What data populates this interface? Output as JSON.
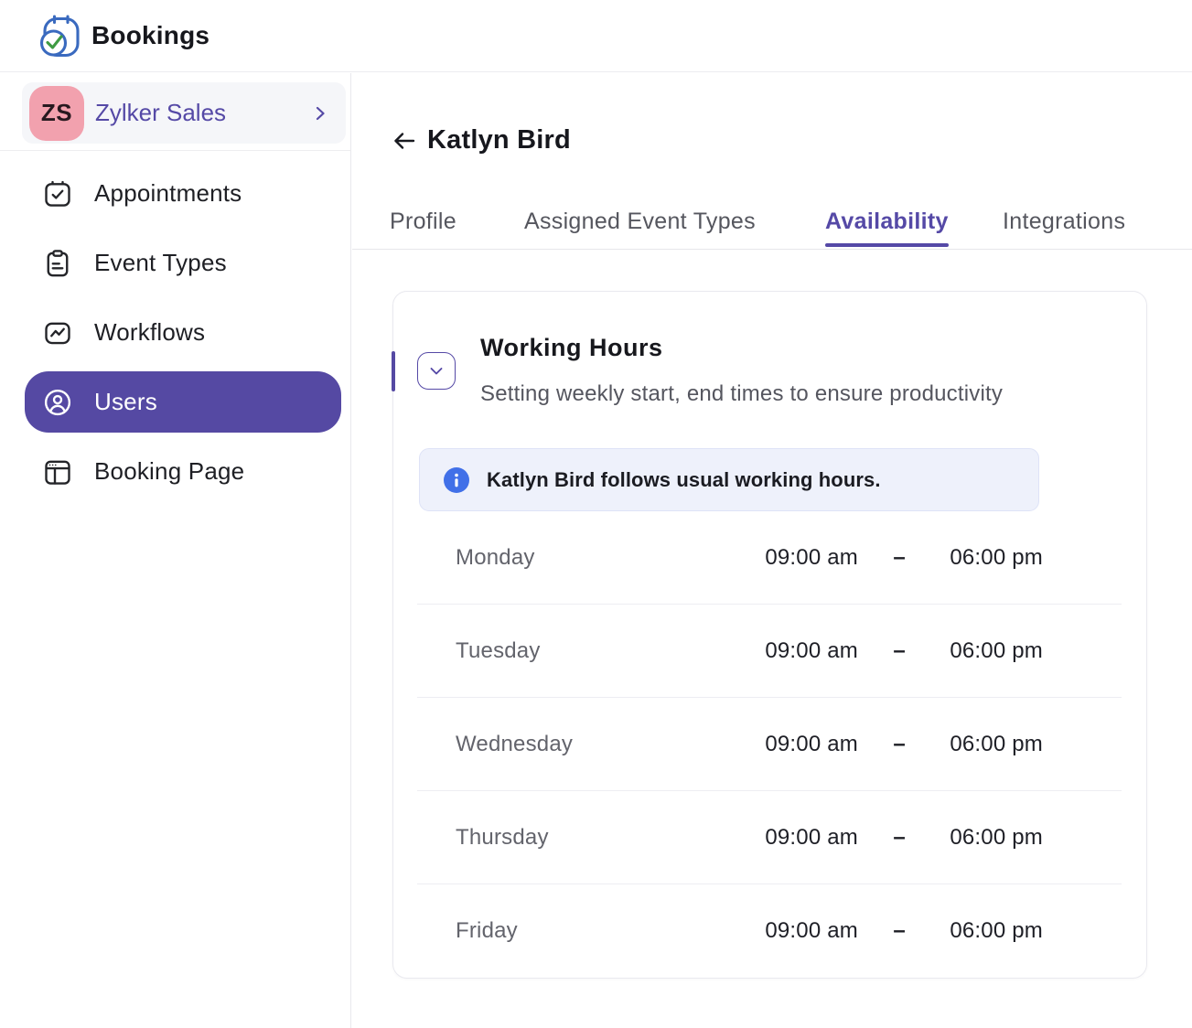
{
  "app": {
    "title": "Bookings",
    "logo_icon": "bookings-calendar-check-logo"
  },
  "sidebar": {
    "org": {
      "initials": "ZS",
      "name": "Zylker Sales",
      "chevron_icon": "chevron-right-icon"
    },
    "items": [
      {
        "label": "Appointments",
        "icon": "calendar-check-icon",
        "active": false
      },
      {
        "label": "Event Types",
        "icon": "clipboard-icon",
        "active": false
      },
      {
        "label": "Workflows",
        "icon": "workflow-pulse-icon",
        "active": false
      },
      {
        "label": "Users",
        "icon": "user-circle-icon",
        "active": true
      },
      {
        "label": "Booking Page",
        "icon": "browser-window-icon",
        "active": false
      }
    ]
  },
  "page": {
    "title": "Katlyn Bird",
    "back_icon": "arrow-left-icon"
  },
  "tabs": [
    {
      "label": "Profile",
      "active": false
    },
    {
      "label": "Assigned Event Types",
      "active": false
    },
    {
      "label": "Availability",
      "active": true
    },
    {
      "label": "Integrations",
      "active": false
    }
  ],
  "working_hours": {
    "title": "Working Hours",
    "subtitle": "Setting weekly start, end times to ensure productivity",
    "collapse_icon": "chevron-down-icon",
    "notice": {
      "icon": "info-icon",
      "text": "Katlyn Bird follows usual working hours."
    },
    "rows": [
      {
        "day": "Monday",
        "start": "09:00 am",
        "separator": "–",
        "end": "06:00 pm"
      },
      {
        "day": "Tuesday",
        "start": "09:00 am",
        "separator": "–",
        "end": "06:00 pm"
      },
      {
        "day": "Wednesday",
        "start": "09:00 am",
        "separator": "–",
        "end": "06:00 pm"
      },
      {
        "day": "Thursday",
        "start": "09:00 am",
        "separator": "–",
        "end": "06:00 pm"
      },
      {
        "day": "Friday",
        "start": "09:00 am",
        "separator": "–",
        "end": "06:00 pm"
      }
    ]
  },
  "colors": {
    "accent_purple": "#5549a3",
    "avatar_pink": "#f2a1ae",
    "info_blue": "#4170e8",
    "notice_bg": "#eef1fb",
    "logo_blue": "#3a6abf",
    "logo_green": "#3f9b43"
  }
}
